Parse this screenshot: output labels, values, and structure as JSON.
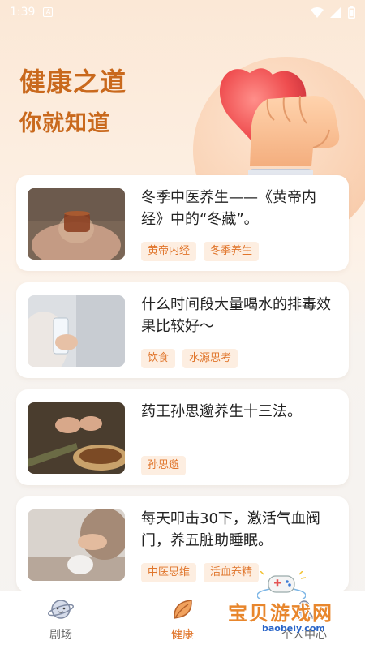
{
  "status_bar": {
    "time": "1:39",
    "notif": "A"
  },
  "hero": {
    "title": "健康之道",
    "subtitle": "你就知道"
  },
  "articles": [
    {
      "title": "冬季中医养生——《黄帝内经》中的“冬藏”。",
      "tags": [
        "黄帝内经",
        "冬季养生"
      ]
    },
    {
      "title": "什么时间段大量喝水的排毒效果比较好～",
      "tags": [
        "饮食",
        "水源思考"
      ]
    },
    {
      "title": "药王孙思邈养生十三法。",
      "tags": [
        "孙思邈"
      ]
    },
    {
      "title": "每天叩击30下，激活气血阀门，养五脏助睡眠。",
      "tags": [
        "中医思维",
        "活血养精"
      ]
    }
  ],
  "tabbar": [
    {
      "label": "剧场",
      "icon": "planet-icon"
    },
    {
      "label": "健康",
      "icon": "leaf-icon"
    },
    {
      "label": "个人中心",
      "icon": "user-icon"
    }
  ],
  "watermark": {
    "text": "宝贝游戏网",
    "url": "baobeiy.com"
  },
  "colors": {
    "accent": "#e0752b",
    "title": "#c9691d",
    "tag_bg": "#fdeee1"
  }
}
